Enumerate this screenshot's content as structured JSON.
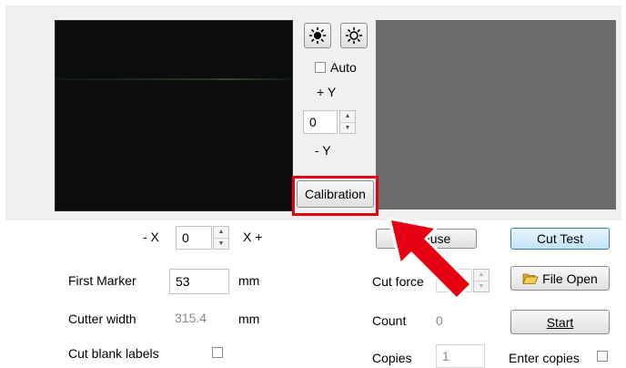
{
  "controls": {
    "auto_label": "Auto",
    "plus_y_label": "+ Y",
    "minus_y_label": "- Y",
    "y_value": "0",
    "calibration_label": "Calibration",
    "minus_x_label": "- X",
    "x_value": "0",
    "plus_x_label": "X +",
    "icons": [
      "brightness-up-icon",
      "brightness-down-icon"
    ]
  },
  "settings": {
    "first_marker_label": "First Marker",
    "first_marker_value": "53",
    "first_marker_unit": "mm",
    "cutter_width_label": "Cutter width",
    "cutter_width_value": "315.4",
    "cutter_width_unit": "mm",
    "cut_blank_labels_label": "Cut blank labels"
  },
  "actions": {
    "pause_label": "Pause",
    "cut_test_label": "Cut Test",
    "cut_force_label": "Cut force",
    "file_open_label": "File Open",
    "count_label": "Count",
    "count_value": "0",
    "start_label": "Start",
    "copies_label": "Copies",
    "copies_value": "1",
    "enter_copies_label": "Enter copies"
  },
  "annotation": {
    "highlight_color": "#e60012"
  }
}
